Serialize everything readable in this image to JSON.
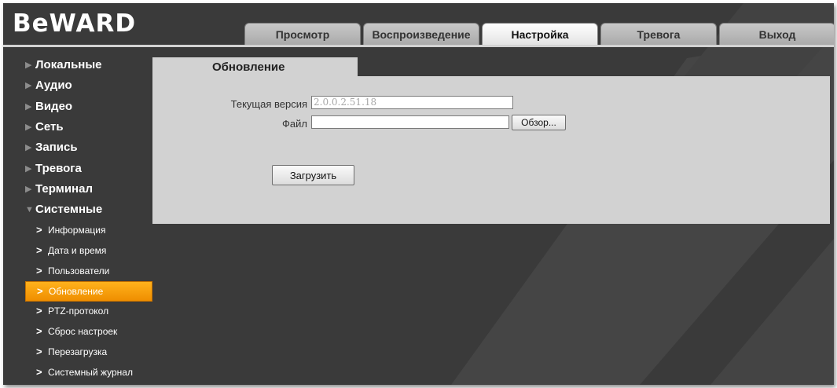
{
  "brand": {
    "logo": "BeWARD"
  },
  "tabs": [
    {
      "label": "Просмотр",
      "active": false
    },
    {
      "label": "Воспроизведение",
      "active": false
    },
    {
      "label": "Настройка",
      "active": true
    },
    {
      "label": "Тревога",
      "active": false
    },
    {
      "label": "Выход",
      "active": false
    }
  ],
  "sidebar": {
    "groups": [
      {
        "label": "Локальные"
      },
      {
        "label": "Аудио"
      },
      {
        "label": "Видео"
      },
      {
        "label": "Сеть"
      },
      {
        "label": "Запись"
      },
      {
        "label": "Тревога"
      },
      {
        "label": "Терминал"
      },
      {
        "label": "Системные",
        "expanded": true
      }
    ],
    "system_items": [
      {
        "label": "Информация"
      },
      {
        "label": "Дата и время"
      },
      {
        "label": "Пользователи"
      },
      {
        "label": "Обновление",
        "active": true
      },
      {
        "label": "PTZ-протокол"
      },
      {
        "label": "Сброс настроек"
      },
      {
        "label": "Перезагрузка"
      },
      {
        "label": "Системный журнал"
      }
    ]
  },
  "panel": {
    "title": "Обновление",
    "current_version_label": "Текущая версия",
    "current_version_value": "2.0.0.2.51.18",
    "file_label": "Файл",
    "file_value": "",
    "browse_button": "Обзор...",
    "upload_button": "Загрузить"
  },
  "colors": {
    "background": "#3a3a3a",
    "panel": "#d2d2d2",
    "active_menu": "#f59a00"
  }
}
